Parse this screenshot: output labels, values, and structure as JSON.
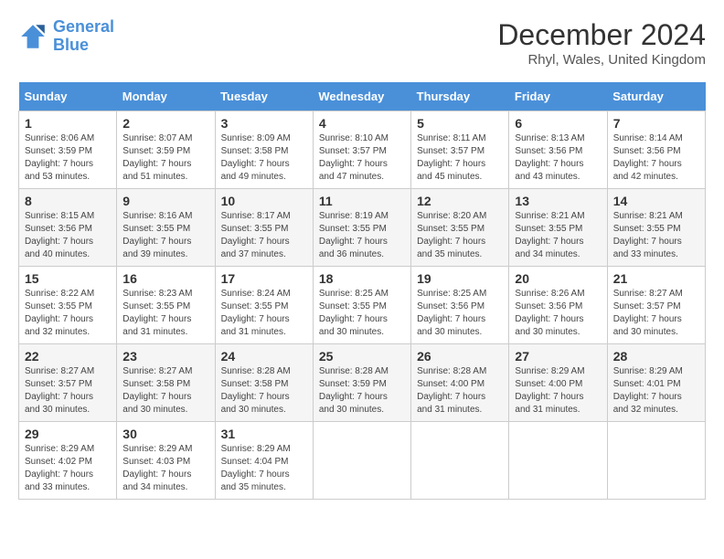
{
  "logo": {
    "line1": "General",
    "line2": "Blue"
  },
  "title": "December 2024",
  "subtitle": "Rhyl, Wales, United Kingdom",
  "days_of_week": [
    "Sunday",
    "Monday",
    "Tuesday",
    "Wednesday",
    "Thursday",
    "Friday",
    "Saturday"
  ],
  "weeks": [
    [
      {
        "day": "1",
        "sunrise": "8:06 AM",
        "sunset": "3:59 PM",
        "daylight": "7 hours and 53 minutes."
      },
      {
        "day": "2",
        "sunrise": "8:07 AM",
        "sunset": "3:59 PM",
        "daylight": "7 hours and 51 minutes."
      },
      {
        "day": "3",
        "sunrise": "8:09 AM",
        "sunset": "3:58 PM",
        "daylight": "7 hours and 49 minutes."
      },
      {
        "day": "4",
        "sunrise": "8:10 AM",
        "sunset": "3:57 PM",
        "daylight": "7 hours and 47 minutes."
      },
      {
        "day": "5",
        "sunrise": "8:11 AM",
        "sunset": "3:57 PM",
        "daylight": "7 hours and 45 minutes."
      },
      {
        "day": "6",
        "sunrise": "8:13 AM",
        "sunset": "3:56 PM",
        "daylight": "7 hours and 43 minutes."
      },
      {
        "day": "7",
        "sunrise": "8:14 AM",
        "sunset": "3:56 PM",
        "daylight": "7 hours and 42 minutes."
      }
    ],
    [
      {
        "day": "8",
        "sunrise": "8:15 AM",
        "sunset": "3:56 PM",
        "daylight": "7 hours and 40 minutes."
      },
      {
        "day": "9",
        "sunrise": "8:16 AM",
        "sunset": "3:55 PM",
        "daylight": "7 hours and 39 minutes."
      },
      {
        "day": "10",
        "sunrise": "8:17 AM",
        "sunset": "3:55 PM",
        "daylight": "7 hours and 37 minutes."
      },
      {
        "day": "11",
        "sunrise": "8:19 AM",
        "sunset": "3:55 PM",
        "daylight": "7 hours and 36 minutes."
      },
      {
        "day": "12",
        "sunrise": "8:20 AM",
        "sunset": "3:55 PM",
        "daylight": "7 hours and 35 minutes."
      },
      {
        "day": "13",
        "sunrise": "8:21 AM",
        "sunset": "3:55 PM",
        "daylight": "7 hours and 34 minutes."
      },
      {
        "day": "14",
        "sunrise": "8:21 AM",
        "sunset": "3:55 PM",
        "daylight": "7 hours and 33 minutes."
      }
    ],
    [
      {
        "day": "15",
        "sunrise": "8:22 AM",
        "sunset": "3:55 PM",
        "daylight": "7 hours and 32 minutes."
      },
      {
        "day": "16",
        "sunrise": "8:23 AM",
        "sunset": "3:55 PM",
        "daylight": "7 hours and 31 minutes."
      },
      {
        "day": "17",
        "sunrise": "8:24 AM",
        "sunset": "3:55 PM",
        "daylight": "7 hours and 31 minutes."
      },
      {
        "day": "18",
        "sunrise": "8:25 AM",
        "sunset": "3:55 PM",
        "daylight": "7 hours and 30 minutes."
      },
      {
        "day": "19",
        "sunrise": "8:25 AM",
        "sunset": "3:56 PM",
        "daylight": "7 hours and 30 minutes."
      },
      {
        "day": "20",
        "sunrise": "8:26 AM",
        "sunset": "3:56 PM",
        "daylight": "7 hours and 30 minutes."
      },
      {
        "day": "21",
        "sunrise": "8:27 AM",
        "sunset": "3:57 PM",
        "daylight": "7 hours and 30 minutes."
      }
    ],
    [
      {
        "day": "22",
        "sunrise": "8:27 AM",
        "sunset": "3:57 PM",
        "daylight": "7 hours and 30 minutes."
      },
      {
        "day": "23",
        "sunrise": "8:27 AM",
        "sunset": "3:58 PM",
        "daylight": "7 hours and 30 minutes."
      },
      {
        "day": "24",
        "sunrise": "8:28 AM",
        "sunset": "3:58 PM",
        "daylight": "7 hours and 30 minutes."
      },
      {
        "day": "25",
        "sunrise": "8:28 AM",
        "sunset": "3:59 PM",
        "daylight": "7 hours and 30 minutes."
      },
      {
        "day": "26",
        "sunrise": "8:28 AM",
        "sunset": "4:00 PM",
        "daylight": "7 hours and 31 minutes."
      },
      {
        "day": "27",
        "sunrise": "8:29 AM",
        "sunset": "4:00 PM",
        "daylight": "7 hours and 31 minutes."
      },
      {
        "day": "28",
        "sunrise": "8:29 AM",
        "sunset": "4:01 PM",
        "daylight": "7 hours and 32 minutes."
      }
    ],
    [
      {
        "day": "29",
        "sunrise": "8:29 AM",
        "sunset": "4:02 PM",
        "daylight": "7 hours and 33 minutes."
      },
      {
        "day": "30",
        "sunrise": "8:29 AM",
        "sunset": "4:03 PM",
        "daylight": "7 hours and 34 minutes."
      },
      {
        "day": "31",
        "sunrise": "8:29 AM",
        "sunset": "4:04 PM",
        "daylight": "7 hours and 35 minutes."
      },
      null,
      null,
      null,
      null
    ]
  ]
}
